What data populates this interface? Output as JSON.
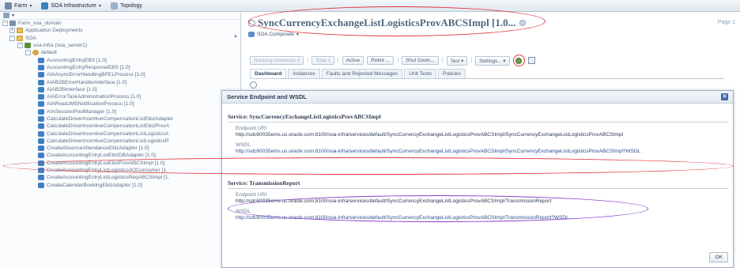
{
  "menubar": {
    "items": [
      {
        "label": "Farm",
        "icon": "farm-icon"
      },
      {
        "label": "SOA Infrastructure",
        "icon": "soa-icon"
      },
      {
        "label": "Topology",
        "icon": "topology-icon"
      }
    ]
  },
  "tree": {
    "root": "Farm_soa_domain",
    "app_deployments": "Application Deployments",
    "soa": "SOA",
    "server": "soa-infra (soa_server1)",
    "partition": "default",
    "composites": [
      "AccountingEntryEBS [1.0]",
      "AccountingEntryResponseEBS [1.0]",
      "AIAAsyncErrorHandlingBPELProcess [1.0]",
      "AIAB2BErrorHandlerInterface [1.0]",
      "AIAB2BInterface [1.0]",
      "AIAErrorTaskAdministrationProcess [1.0]",
      "AIAReadJMSNotificationProcess [1.0]",
      "AIASessionPoolManager [1.0]",
      "CalculateDriverIncentiveCompensationListEbizAdapter",
      "CalculateDriverIncentiveCompensationListEbizProvA",
      "CalculateDriverIncentiveCompensationListLogisticsA",
      "CalculateDriverIncentiveCompensationListLogisticsR",
      "CreateAbsenceAttendanceEbizAdapter [1.0]",
      "CreateAccountingEntryListEbizDBAdapter [1.0]",
      "CreateAccountingEntryListEbizProvABCSImpl [1.0]",
      "CreateAccountingEntryListLogisticsAQConsumer [1.",
      "CreateAccountingEntryListLogisticsReqABCSImpl [1.",
      "CreateCalendarBookingEbizAdapter [1.0]"
    ]
  },
  "composite": {
    "title": "SyncCurrencyExchangeListLogisticsProvABCSImpl [1.0...",
    "menu_label": "SOA Composite",
    "pagination": "Page 1"
  },
  "toolbar": {
    "running": "Running Instances 0",
    "total": "Total 0",
    "active": "Active",
    "retire": "Retire ...",
    "shutdown": "Shut Down...",
    "test": "Test ▾",
    "settings": "Settings... ▾"
  },
  "tabs": [
    "Dashboard",
    "Instances",
    "Faults and Rejected Messages",
    "Unit Tests",
    "Policies"
  ],
  "dialog": {
    "title": "Service Endpoint and WSDL",
    "services": [
      {
        "heading": "Service: SyncCurrencyExchangeListLogisticsProvABCSImpl",
        "endpoint_label": "Endpoint URI",
        "endpoint_value": "http://sdc60035ems.us.oracle.com:8100/soa-infra/services/default/SyncCurrencyExchangeListLogisticsProvABCSImpl/SyncCurrencyExchangeListLogisticsProvABCSImpl",
        "wsdl_label": "WSDL",
        "wsdl_value": "http://sdc60035ems.us.oracle.com:8100/soa-infra/services/default/SyncCurrencyExchangeListLogisticsProvABCSImpl/SyncCurrencyExchangeListLogisticsProvABCSImpl?WSDL"
      },
      {
        "heading": "Service: TransmissionReport",
        "endpoint_label": "Endpoint URI",
        "endpoint_value": "http://sdc60035ems.us.oracle.com:8100/soa-infra/services/default/SyncCurrencyExchangeListLogisticsProvABCSImpl/TransmissionReport",
        "wsdl_label": "WSDL",
        "wsdl_value": "http://sdc60035ems.us.oracle.com:8100/soa-infra/services/default/SyncCurrencyExchangeListLogisticsProvABCSImpl/TransmissionReport?WSDL"
      }
    ],
    "ok_label": "OK",
    "close_glyph": "✕"
  },
  "colors": {
    "highlight_red": "#e0353a",
    "highlight_purple": "#8a3fd1",
    "link_blue": "#2c4f8f",
    "title_slate": "#4d6680"
  }
}
